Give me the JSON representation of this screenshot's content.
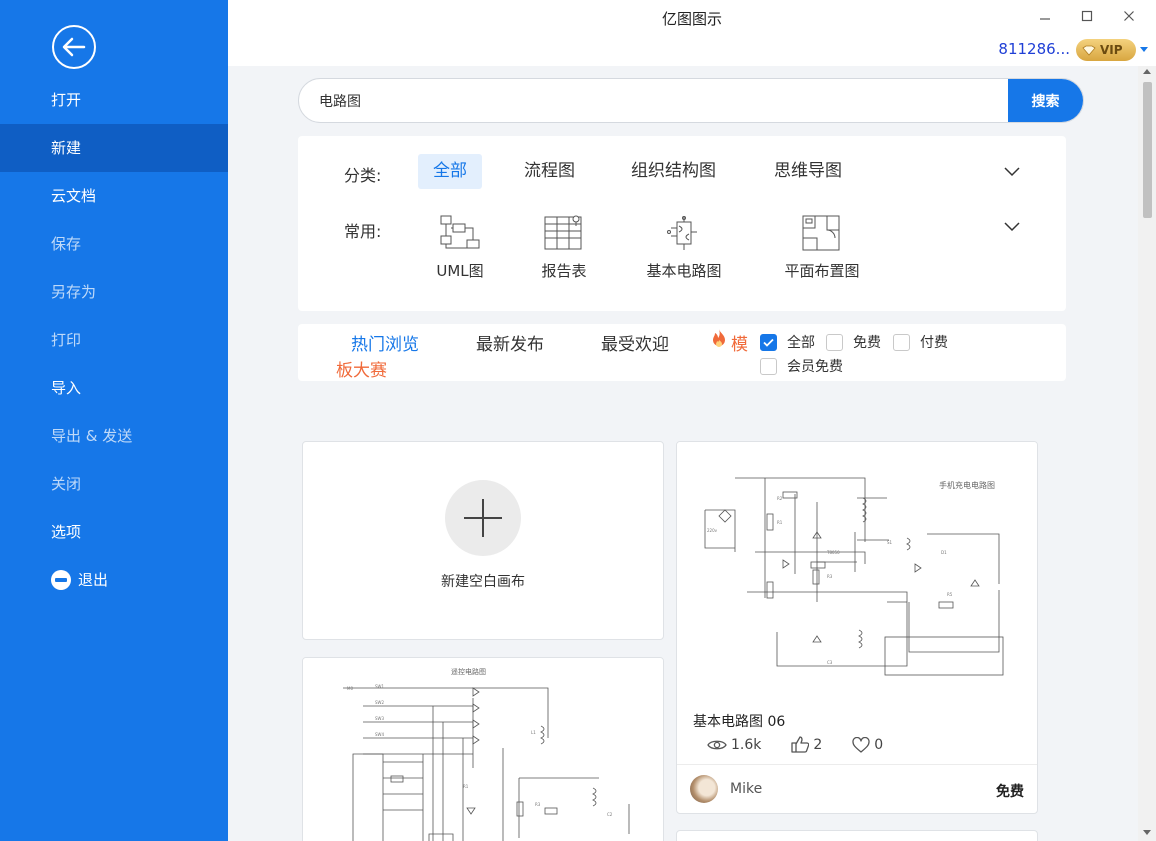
{
  "window": {
    "title": "亿图图示"
  },
  "account": {
    "id": "811286...",
    "vip_label": "VIP"
  },
  "sidebar": {
    "items": [
      {
        "label": "打开",
        "state": "normal"
      },
      {
        "label": "新建",
        "state": "active"
      },
      {
        "label": "云文档",
        "state": "normal"
      },
      {
        "label": "保存",
        "state": "dim"
      },
      {
        "label": "另存为",
        "state": "dim"
      },
      {
        "label": "打印",
        "state": "dim"
      },
      {
        "label": "导入",
        "state": "normal"
      },
      {
        "label": "导出 & 发送",
        "state": "dim"
      },
      {
        "label": "关闭",
        "state": "dim"
      },
      {
        "label": "选项",
        "state": "normal"
      },
      {
        "label": "退出",
        "state": "normal"
      }
    ]
  },
  "search": {
    "value": "电路图",
    "button": "搜索"
  },
  "categories": {
    "label": "分类:",
    "tabs": [
      "全部",
      "流程图",
      "组织结构图",
      "思维导图"
    ],
    "active": "全部"
  },
  "common": {
    "label": "常用:",
    "templates": [
      {
        "label": "UML图",
        "icon": "uml-icon"
      },
      {
        "label": "报告表",
        "icon": "report-icon"
      },
      {
        "label": "基本电路图",
        "icon": "circuit-icon"
      },
      {
        "label": "平面布置图",
        "icon": "floorplan-icon"
      }
    ]
  },
  "filters": {
    "tabs": [
      "热门浏览",
      "最新发布",
      "最受欢迎"
    ],
    "active": "热门浏览",
    "contest_line1": "模",
    "contest_line2": "板大赛",
    "checkboxes": [
      {
        "label": "全部",
        "checked": true
      },
      {
        "label": "免费",
        "checked": false
      },
      {
        "label": "付费",
        "checked": false
      },
      {
        "label": "会员免费",
        "checked": false
      }
    ]
  },
  "new_blank": {
    "label": "新建空白画布"
  },
  "template_card": {
    "title": "基本电路图 06",
    "thumb_title": "手机充电电路图",
    "views": "1.6k",
    "likes": "2",
    "favorites": "0",
    "author": "Mike",
    "price": "免费"
  },
  "template_card_2": {
    "thumb_title": "遥控电路图"
  },
  "colors": {
    "primary": "#1677e8",
    "sidebar_active": "#0f5ec4",
    "accent": "#f06a3a"
  }
}
